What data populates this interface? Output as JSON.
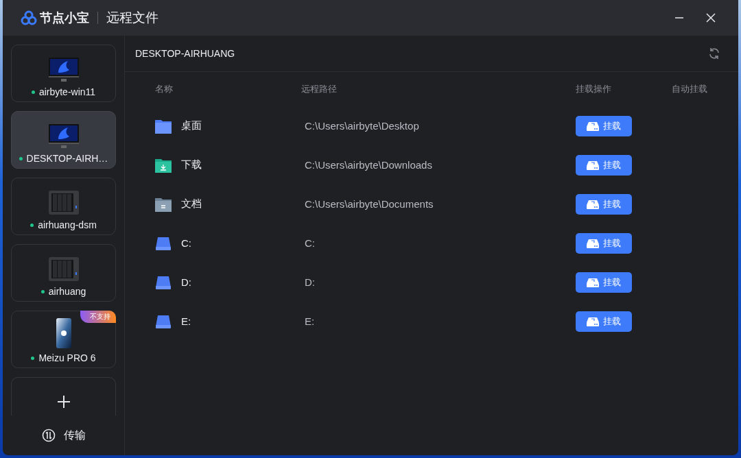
{
  "window": {
    "app_name": "节点小宝",
    "title": "远程文件"
  },
  "sidebar": {
    "devices": [
      {
        "kind": "pc",
        "name": "airbyte-win11",
        "online": true,
        "selected": false
      },
      {
        "kind": "pc",
        "name": "DESKTOP-AIRH…",
        "online": true,
        "selected": true
      },
      {
        "kind": "nas",
        "name": "airhuang-dsm",
        "online": true,
        "selected": false
      },
      {
        "kind": "nas",
        "name": "airhuang",
        "online": true,
        "selected": false
      },
      {
        "kind": "phone",
        "name": "Meizu PRO 6",
        "online": true,
        "selected": false,
        "badge": "不支持"
      }
    ],
    "transfer": "传输"
  },
  "main": {
    "device_title": "DESKTOP-AIRHUANG",
    "columns": [
      "名称",
      "远程路径",
      "挂载操作",
      "自动挂载"
    ],
    "rows": [
      {
        "kind": "folder",
        "name": "桌面",
        "path": "C:\\Users\\airbyte\\Desktop",
        "action": "挂载"
      },
      {
        "kind": "download",
        "name": "下载",
        "path": "C:\\Users\\airbyte\\Downloads",
        "action": "挂载"
      },
      {
        "kind": "document",
        "name": "文档",
        "path": "C:\\Users\\airbyte\\Documents",
        "action": "挂载"
      },
      {
        "kind": "drive",
        "name": "C:",
        "path": "C:",
        "action": "挂载"
      },
      {
        "kind": "drive",
        "name": "D:",
        "path": "D:",
        "action": "挂载"
      },
      {
        "kind": "drive",
        "name": "E:",
        "path": "E:",
        "action": "挂载"
      }
    ]
  }
}
